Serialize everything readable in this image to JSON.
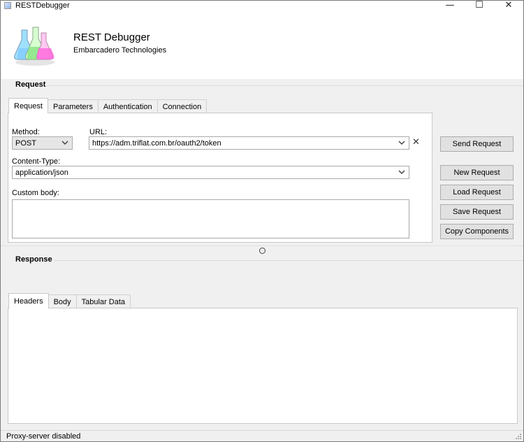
{
  "window": {
    "title": "RESTDebugger",
    "controls": [
      "—",
      "☐",
      "✕"
    ]
  },
  "header": {
    "app_name": "REST Debugger",
    "company": "Embarcadero Technologies",
    "logo_icon": "flasks-logo-icon"
  },
  "request": {
    "section_label": "Request",
    "tabs": [
      {
        "label": "Request",
        "active": true
      },
      {
        "label": "Parameters",
        "active": false
      },
      {
        "label": "Authentication",
        "active": false
      },
      {
        "label": "Connection",
        "active": false
      }
    ],
    "method_label": "Method:",
    "method_value": "POST",
    "url_label": "URL:",
    "url_value": "https://adm.triflat.com.br/oauth2/token",
    "content_type_label": "Content-Type:",
    "content_type_value": "application/json",
    "custom_body_label": "Custom body:",
    "custom_body_value": ""
  },
  "actions": {
    "send": "Send Request",
    "new": "New Request",
    "load": "Load Request",
    "save": "Save Request",
    "copy": "Copy Components"
  },
  "response": {
    "section_label": "Response",
    "tabs": [
      {
        "label": "Headers",
        "active": true
      },
      {
        "label": "Body",
        "active": false
      },
      {
        "label": "Tabular Data",
        "active": false
      }
    ]
  },
  "status": {
    "text": "Proxy-server disabled"
  }
}
